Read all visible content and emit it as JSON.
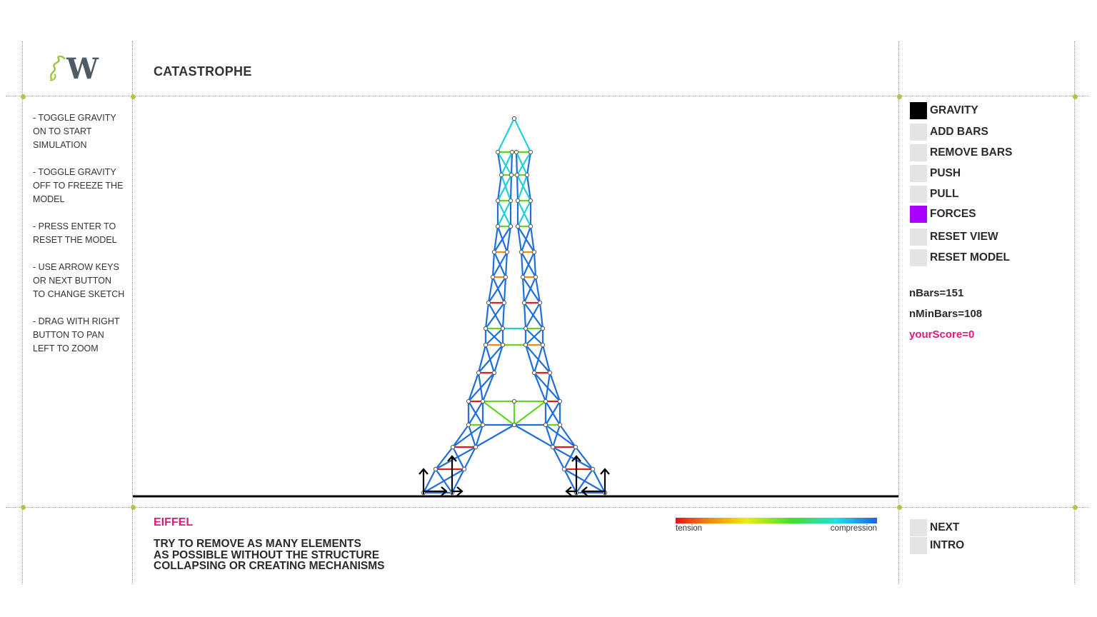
{
  "app": {
    "title": "CATASTROPHE"
  },
  "instructions": [
    "- TOGGLE GRAVITY ON TO START SIMULATION",
    "- TOGGLE GRAVITY OFF TO FREEZE THE MODEL",
    "- PRESS ENTER TO RESET THE MODEL",
    "- USE ARROW KEYS OR NEXT BUTTON TO CHANGE SKETCH",
    "- DRAG WITH RIGHT BUTTON TO PAN LEFT TO ZOOM"
  ],
  "menu": [
    {
      "label": "GRAVITY",
      "box_color": "#000000"
    },
    {
      "label": "ADD BARS",
      "box_color": "#e4e4e4"
    },
    {
      "label": "REMOVE BARS",
      "box_color": "#e4e4e4"
    },
    {
      "label": "PUSH",
      "box_color": "#e4e4e4"
    },
    {
      "label": "PULL",
      "box_color": "#e4e4e4"
    },
    {
      "label": "FORCES",
      "box_color": "#aa00ff"
    },
    {
      "label": "RESET VIEW",
      "box_color": "#e4e4e4"
    },
    {
      "label": "RESET MODEL",
      "box_color": "#e4e4e4"
    }
  ],
  "stats": {
    "nbars": "nBars=151",
    "nminbars": "nMinBars=108",
    "score": "yourScore=0"
  },
  "sketch": {
    "name": "EIFFEL",
    "task_lines": [
      "TRY TO REMOVE AS MANY ELEMENTS",
      "AS POSSIBLE WITHOUT THE STRUCTURE",
      "COLLAPSING OR CREATING MECHANISMS"
    ]
  },
  "legend": {
    "tension": "tension",
    "compression": "compression"
  },
  "bottom_menu": [
    {
      "label": "NEXT"
    },
    {
      "label": "INTRO"
    }
  ],
  "colors": {
    "accent": "#e0197d",
    "guide_dot": "#a8c94a",
    "blue_bar": "#1e6fdc",
    "red_bar": "#e02020",
    "green_bar": "#5ed820",
    "cyan_bar": "#20d0d8",
    "orange_bar": "#f08a18"
  },
  "icons": [
    "logo-spring-w-icon",
    "support-arrow-icon"
  ]
}
